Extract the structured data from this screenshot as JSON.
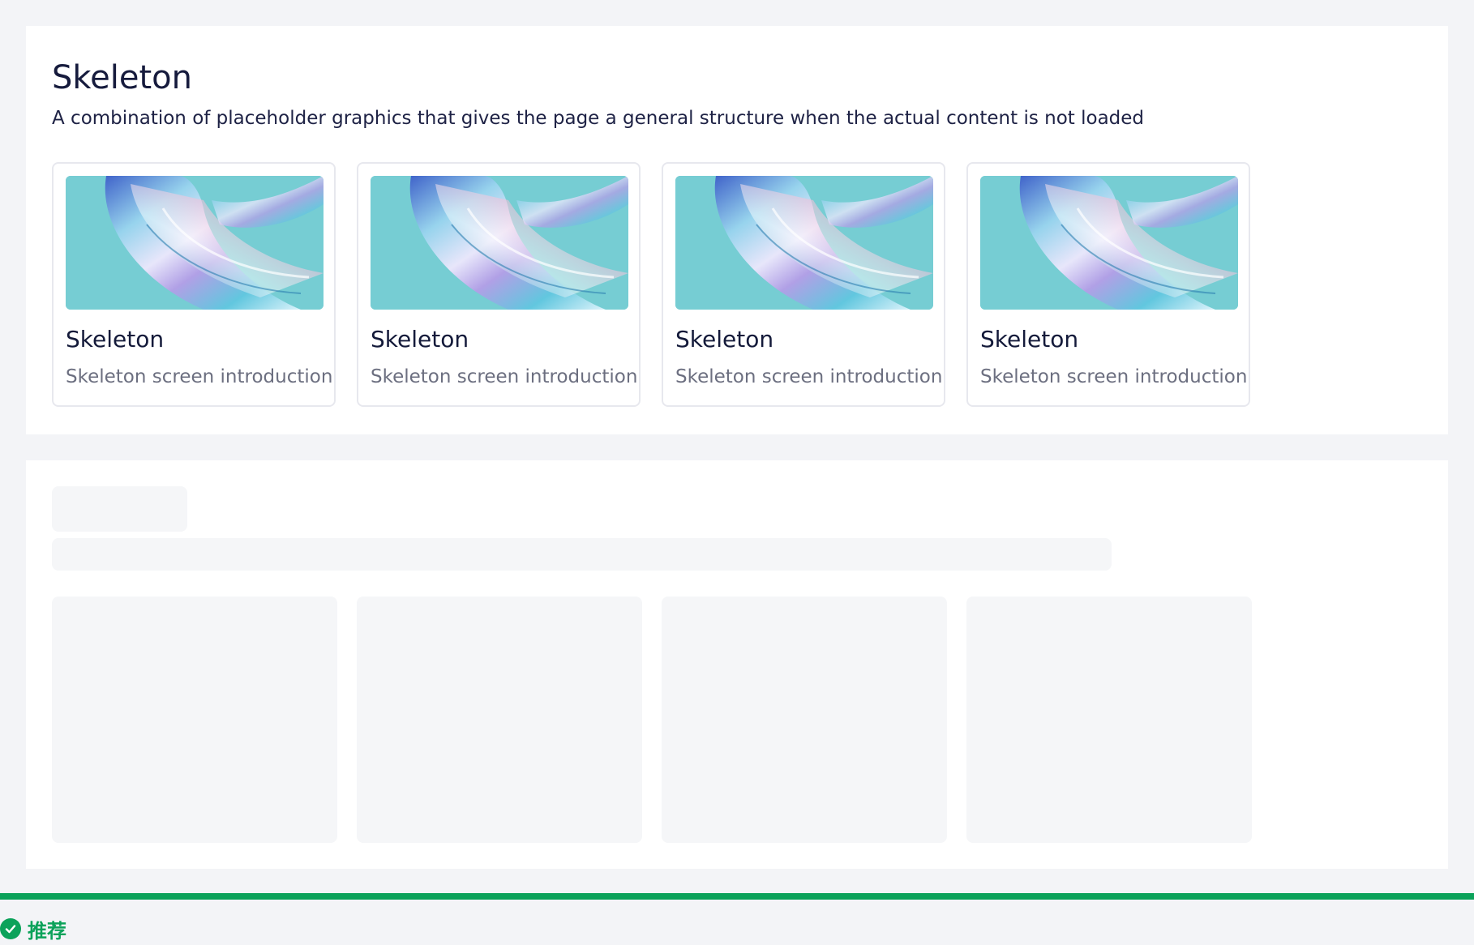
{
  "header": {
    "title": "Skeleton",
    "description": "A combination of placeholder graphics that gives the page a general structure when the actual content is not loaded"
  },
  "cards": [
    {
      "title": "Skeleton",
      "subtitle": "Skeleton screen introduction",
      "image": "iridescent-glass-wave"
    },
    {
      "title": "Skeleton",
      "subtitle": "Skeleton screen introduction",
      "image": "iridescent-glass-wave"
    },
    {
      "title": "Skeleton",
      "subtitle": "Skeleton screen introduction",
      "image": "iridescent-glass-wave"
    },
    {
      "title": "Skeleton",
      "subtitle": "Skeleton screen introduction",
      "image": "iridescent-glass-wave"
    }
  ],
  "skeleton": {
    "placeholder_cards": 4
  },
  "footer": {
    "badge_label": "推荐",
    "badge_icon": "check-circle-icon"
  },
  "colors": {
    "page_background": "#f3f4f7",
    "panel_background": "#ffffff",
    "skeleton_fill": "#f5f6f8",
    "image_background": "#76cdd3",
    "accent_green": "#0ba25a"
  }
}
